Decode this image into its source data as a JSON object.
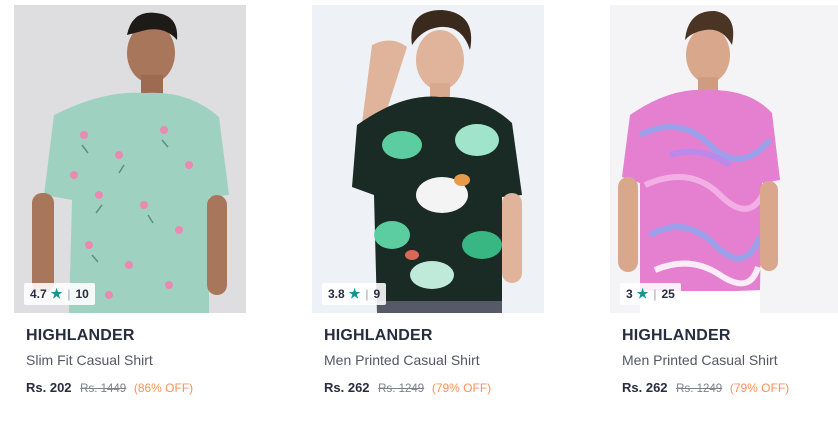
{
  "products": [
    {
      "brand": "HIGHLANDER",
      "title": "Slim Fit Casual Shirt",
      "price": "Rs. 202",
      "mrp": "Rs. 1449",
      "discount": "(86% OFF)",
      "rating": "4.7",
      "rating_count": "10",
      "shirt_color": "#9fd1c1",
      "print_color": "#e98ab0",
      "background": "#d9d9dc"
    },
    {
      "brand": "HIGHLANDER",
      "title": "Men Printed Casual Shirt",
      "price": "Rs. 262",
      "mrp": "Rs. 1249",
      "discount": "(79% OFF)",
      "rating": "3.8",
      "rating_count": "9",
      "shirt_color": "#1a2a25",
      "print_color": "#5fd6a8",
      "background": "#eef1f6"
    },
    {
      "brand": "HIGHLANDER",
      "title": "Men Printed Casual Shirt",
      "price": "Rs. 262",
      "mrp": "Rs. 1249",
      "discount": "(79% OFF)",
      "rating": "3",
      "rating_count": "25",
      "shirt_color": "#e57fd0",
      "print_color": "#8fa6ef",
      "background": "#f4f4f6"
    }
  ],
  "icons": {
    "rating": "star-icon"
  },
  "colors": {
    "star": "#14958f",
    "discount": "#ff905a"
  }
}
